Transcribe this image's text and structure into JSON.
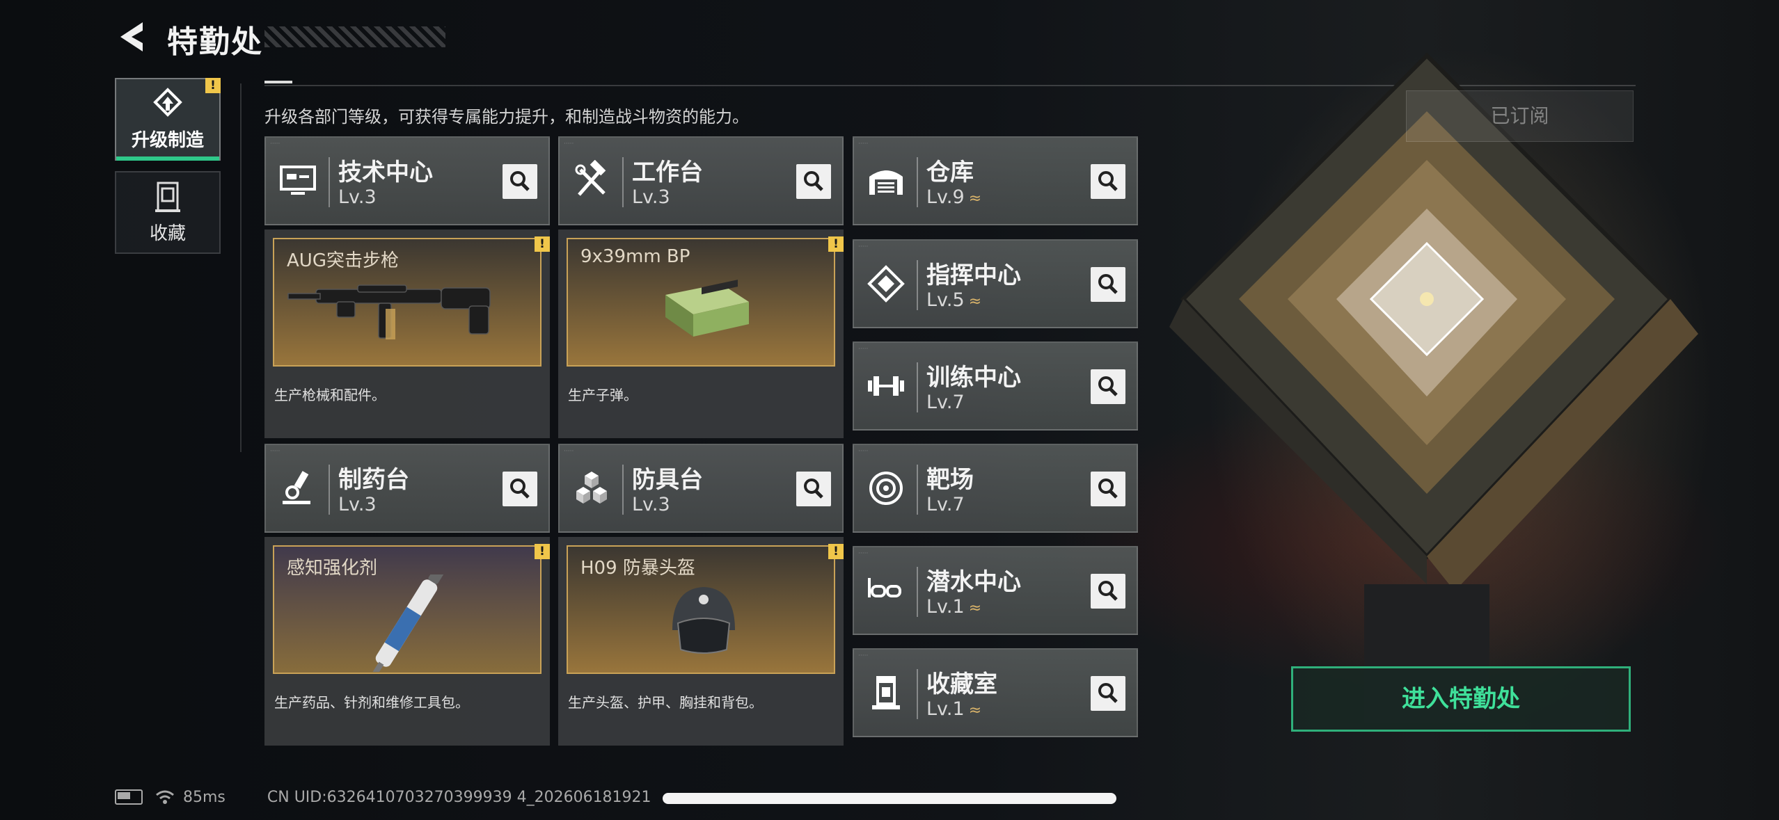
{
  "header": {
    "title": "特勤处"
  },
  "description": "升级各部门等级，可获得专属能力提升，和制造战斗物资的能力。",
  "tabs": [
    {
      "label": "升级制造",
      "active": true,
      "alert": "!"
    },
    {
      "label": "收藏",
      "active": false
    }
  ],
  "departments_left": [
    {
      "name": "技术中心",
      "level": "Lv.3",
      "icon": "monitor-icon"
    },
    {
      "name": "工作台",
      "level": "Lv.3",
      "icon": "hammer-wrench-icon"
    },
    {
      "name": "制药台",
      "level": "Lv.3",
      "icon": "microscope-icon"
    },
    {
      "name": "防具台",
      "level": "Lv.3",
      "icon": "cubes-icon"
    }
  ],
  "products": [
    {
      "name": "AUG突击步枪",
      "desc": "生产枪械和配件。",
      "alert": "!",
      "icon": "rifle-icon"
    },
    {
      "name": "9x39mm BP",
      "desc": "生产子弹。",
      "alert": "!",
      "icon": "ammo-box-icon"
    },
    {
      "name": "感知强化剂",
      "desc": "生产药品、针剂和维修工具包。",
      "alert": "!",
      "icon": "injector-icon"
    },
    {
      "name": "H09 防暴头盔",
      "desc": "生产头盔、护甲、胸挂和背包。",
      "alert": "!",
      "icon": "helmet-icon"
    }
  ],
  "departments_right": [
    {
      "name": "仓库",
      "level": "Lv.9",
      "upgradeable": true,
      "icon": "warehouse-icon"
    },
    {
      "name": "指挥中心",
      "level": "Lv.5",
      "upgradeable": true,
      "icon": "chip-icon"
    },
    {
      "name": "训练中心",
      "level": "Lv.7",
      "upgradeable": false,
      "icon": "dumbbell-icon"
    },
    {
      "name": "靶场",
      "level": "Lv.7",
      "upgradeable": false,
      "icon": "target-icon"
    },
    {
      "name": "潜水中心",
      "level": "Lv.1",
      "upgradeable": true,
      "icon": "diving-mask-icon"
    },
    {
      "name": "收藏室",
      "level": "Lv.1",
      "upgradeable": true,
      "icon": "trophy-case-icon"
    }
  ],
  "upgrade_chevron": "≈",
  "subscribed_label": "已订阅",
  "enter_button": "进入特勤处",
  "status": {
    "ping": "85ms",
    "uid": "CN UID:6326410703270399939 4_202606181921"
  },
  "colors": {
    "accent_green": "#2fb07b",
    "alert_yellow": "#f0c64a",
    "frame_gold": "#c9a257"
  }
}
